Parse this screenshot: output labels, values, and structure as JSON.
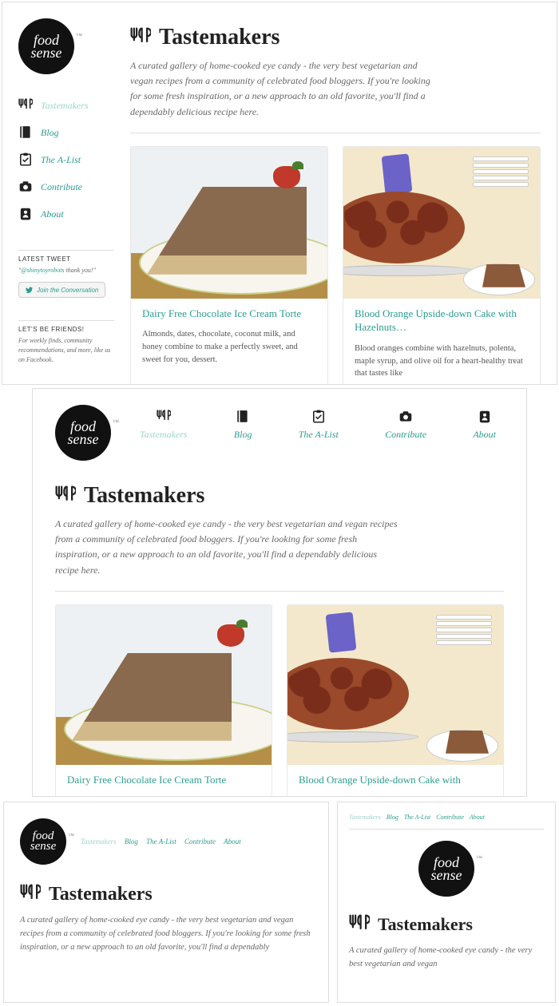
{
  "brand": "food sense",
  "nav": {
    "items": [
      {
        "label": "Tastemakers",
        "icon": "utensils"
      },
      {
        "label": "Blog",
        "icon": "book"
      },
      {
        "label": "The A-List",
        "icon": "clipboard"
      },
      {
        "label": "Contribute",
        "icon": "camera"
      },
      {
        "label": "About",
        "icon": "address"
      }
    ]
  },
  "page": {
    "title": "Tastemakers",
    "intro": "A curated gallery of home-cooked eye candy - the very best vegetarian and vegan recipes from a community of celebrated food bloggers. If you're looking for some fresh inspiration, or a new approach to an old favorite, you'll find a dependably delicious recipe here."
  },
  "sidebar": {
    "tweet": {
      "header": "LATEST TWEET",
      "handle": "@shinytoyrobots",
      "text_after": " thank you!\"",
      "text_before": "\"",
      "button": "Join the Conversation"
    },
    "friends": {
      "header": "LET'S BE FRIENDS!",
      "text": "For weekly finds, community recommendations, and more, like us on Facebook."
    }
  },
  "cards": [
    {
      "title": "Dairy Free Chocolate Ice Cream Torte",
      "desc": "Almonds, dates, chocolate, coconut milk, and honey combine to make a perfectly sweet, and sweet for you, dessert."
    },
    {
      "title": "Blood Orange Upside-down Cake with Hazelnuts…",
      "title_short": "Blood Orange Upside-down Cake with",
      "desc": "Blood oranges combine with hazelnuts, polenta, maple syrup, and olive oil for a heart-healthy treat that tastes like"
    }
  ],
  "p3": {
    "intro": "A curated gallery of home-cooked eye candy - the very best vegetarian and vegan recipes from a community of celebrated food bloggers. If you're looking for some fresh inspiration, or a new approach to an old favorite, you'll find a dependably"
  },
  "p4": {
    "intro": "A curated gallery of home-cooked eye candy - the very best vegetarian and vegan"
  }
}
